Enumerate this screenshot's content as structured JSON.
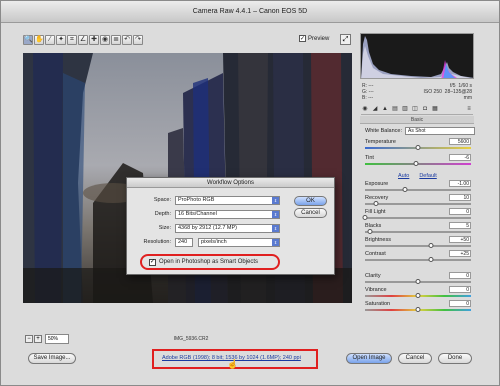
{
  "window": {
    "title": "Camera Raw 4.4.1  –  Canon EOS 5D"
  },
  "toolbar": {
    "tools": [
      {
        "name": "zoom-tool-icon",
        "glyph": "🔍"
      },
      {
        "name": "hand-tool-icon",
        "glyph": "✋"
      },
      {
        "name": "white-balance-tool-icon",
        "glyph": "⁄"
      },
      {
        "name": "color-sampler-tool-icon",
        "glyph": "✦"
      },
      {
        "name": "crop-tool-icon",
        "glyph": "⌗"
      },
      {
        "name": "straighten-tool-icon",
        "glyph": "∠"
      },
      {
        "name": "retouch-tool-icon",
        "glyph": "✚"
      },
      {
        "name": "red-eye-tool-icon",
        "glyph": "◉"
      },
      {
        "name": "preferences-icon",
        "glyph": "≣"
      },
      {
        "name": "rotate-ccw-icon",
        "glyph": "↶"
      },
      {
        "name": "rotate-cw-icon",
        "glyph": "↷"
      }
    ],
    "preview_label": "Preview",
    "preview_checked": "✓"
  },
  "readout": {
    "r": "R:",
    "g": "G:",
    "b": "B:",
    "r_val": "---",
    "g_val": "---",
    "b_val": "---",
    "aperture": "f/5",
    "shutter": "1/60 s",
    "iso": "ISO 250",
    "lens": "28–135@28 mm"
  },
  "panel": {
    "title": "Basic",
    "white_balance_label": "White Balance:",
    "white_balance_value": "As Shot",
    "auto": "Auto",
    "default": "Default",
    "sliders": [
      {
        "key": "temperature",
        "label": "Temperature",
        "value": "5600",
        "pos": 0.5
      },
      {
        "key": "tint",
        "label": "Tint",
        "value": "-6",
        "pos": 0.48
      },
      {
        "key": "exposure",
        "label": "Exposure",
        "value": "-1.00",
        "pos": 0.38
      },
      {
        "key": "recovery",
        "label": "Recovery",
        "value": "10",
        "pos": 0.1
      },
      {
        "key": "fill-light",
        "label": "Fill Light",
        "value": "0",
        "pos": 0.0
      },
      {
        "key": "blacks",
        "label": "Blacks",
        "value": "5",
        "pos": 0.05
      },
      {
        "key": "brightness",
        "label": "Brightness",
        "value": "+50",
        "pos": 0.62
      },
      {
        "key": "contrast",
        "label": "Contrast",
        "value": "+25",
        "pos": 0.62
      },
      {
        "key": "clarity",
        "label": "Clarity",
        "value": "0",
        "pos": 0.5
      },
      {
        "key": "vibrance",
        "label": "Vibrance",
        "value": "0",
        "pos": 0.5
      },
      {
        "key": "saturation",
        "label": "Saturation",
        "value": "0",
        "pos": 0.5
      }
    ]
  },
  "canvas": {
    "zoom_value": "50%",
    "filename": "IMG_5936.CR2"
  },
  "dialog": {
    "title": "Workflow Options",
    "space_label": "Space:",
    "space_value": "ProPhoto RGB",
    "depth_label": "Depth:",
    "depth_value": "16 Bits/Channel",
    "size_label": "Size:",
    "size_value": "4368 by 2912  (12.7 MP)",
    "resolution_label": "Resolution:",
    "resolution_value": "240",
    "resolution_unit": "pixels/inch",
    "ok": "OK",
    "cancel": "Cancel",
    "smart_objects_label": "Open in Photoshop as Smart Objects",
    "smart_objects_checked": "✓"
  },
  "bottom": {
    "save": "Save Image...",
    "workflow_link": "Adobe RGB (1998); 8 bit; 1536 by 1024 (1.6MP); 240 ppi",
    "open": "Open Image",
    "cancel": "Cancel",
    "done": "Done"
  }
}
